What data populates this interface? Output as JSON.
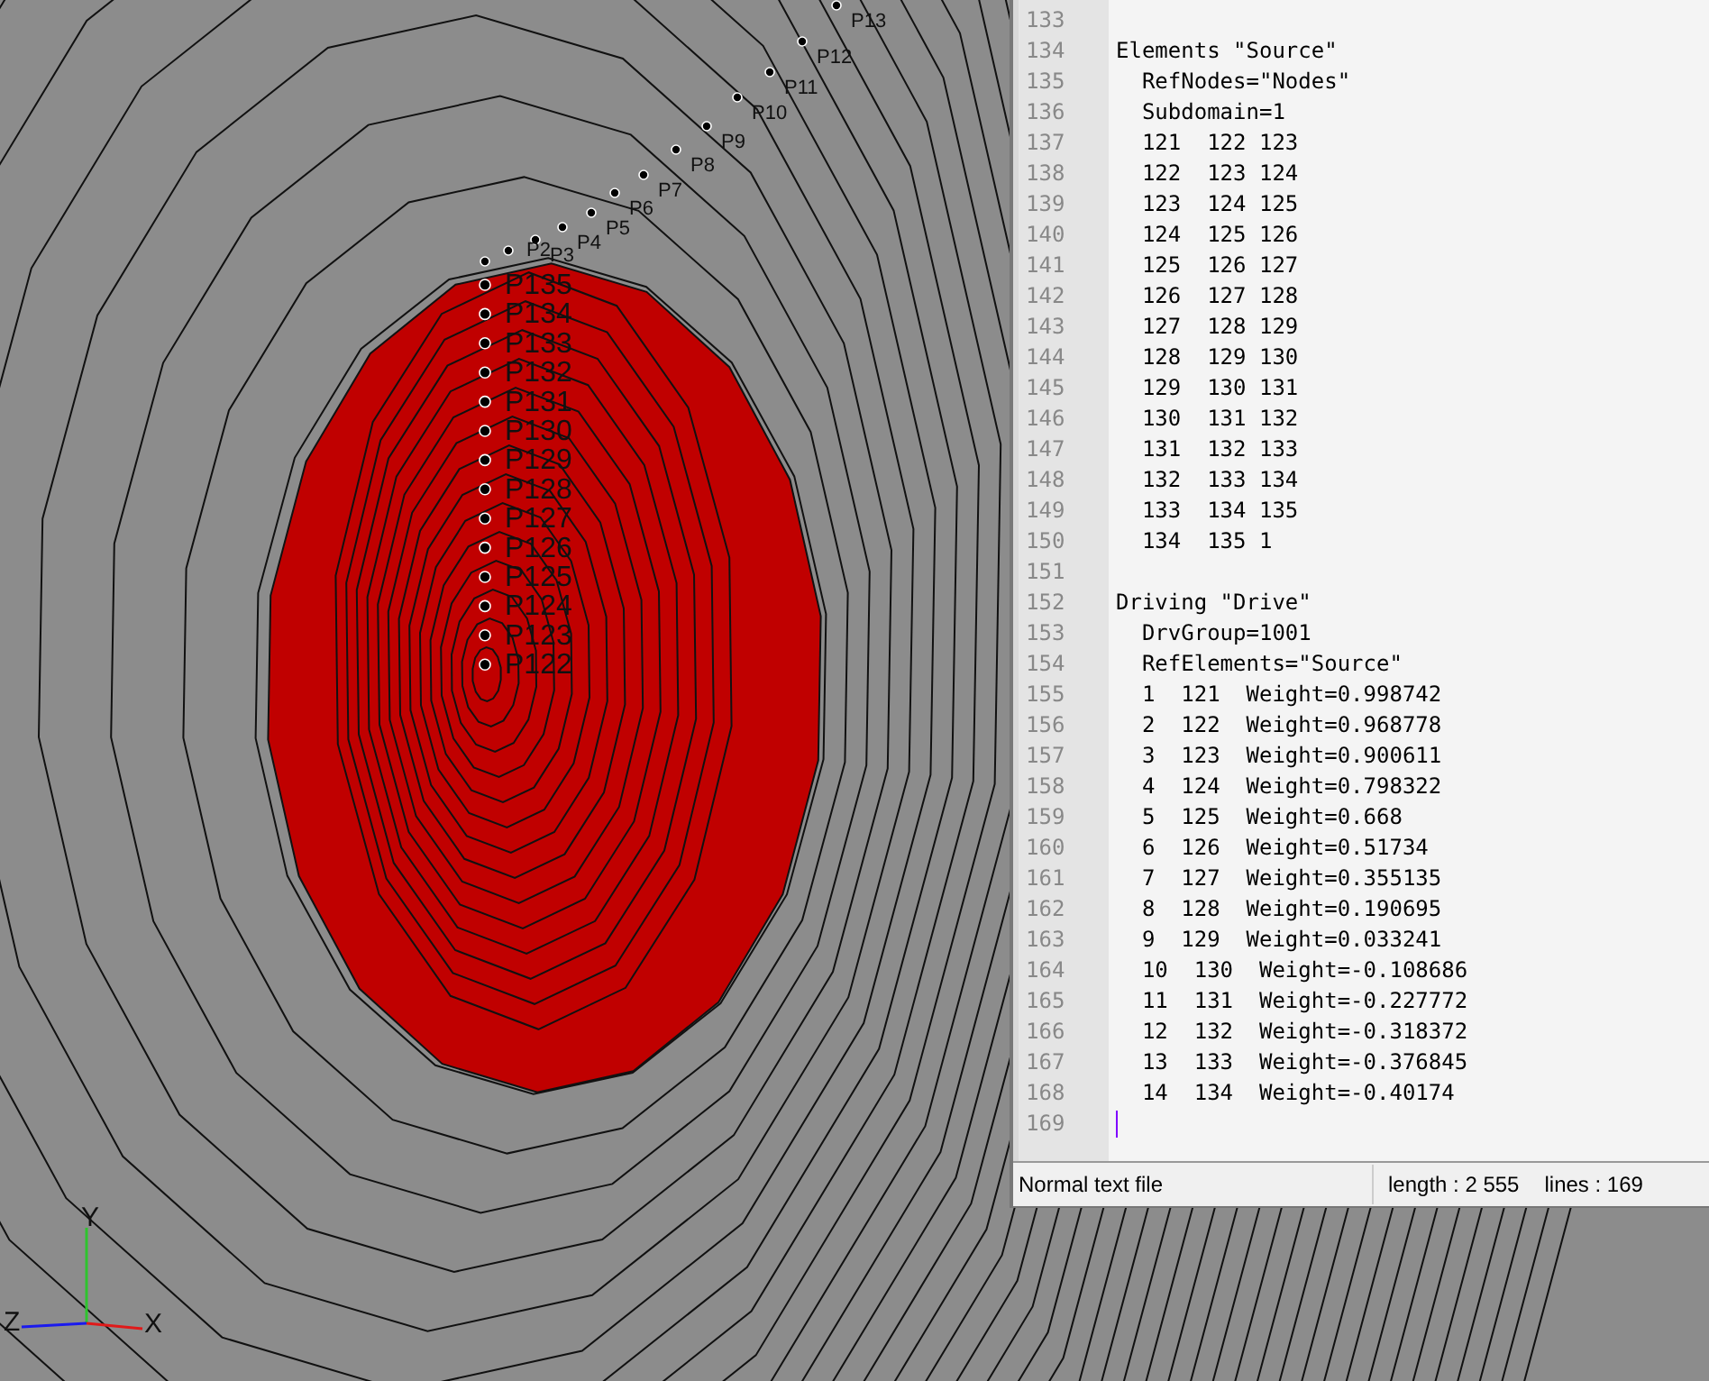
{
  "viewport": {
    "lower_node_labels": [
      "P135",
      "P134",
      "P133",
      "P132",
      "P131",
      "P130",
      "P129",
      "P128",
      "P127",
      "P126",
      "P125",
      "P124",
      "P123",
      "P122"
    ],
    "upper_node_labels": [
      "P2",
      "P3",
      "P4",
      "P5",
      "P6",
      "P7",
      "P8",
      "P9",
      "P10",
      "P11",
      "P12",
      "P13"
    ],
    "axes": {
      "x": "X",
      "y": "Y",
      "z": "Z"
    }
  },
  "editor": {
    "lines": [
      {
        "number": "133"
      },
      {
        "number": "134",
        "text": "Elements \"Source\""
      },
      {
        "number": "135",
        "text": "  RefNodes=\"Nodes\""
      },
      {
        "number": "136",
        "text": "  Subdomain=1"
      },
      {
        "number": "137",
        "text": "  121  122 123"
      },
      {
        "number": "138",
        "text": "  122  123 124"
      },
      {
        "number": "139",
        "text": "  123  124 125"
      },
      {
        "number": "140",
        "text": "  124  125 126"
      },
      {
        "number": "141",
        "text": "  125  126 127"
      },
      {
        "number": "142",
        "text": "  126  127 128"
      },
      {
        "number": "143",
        "text": "  127  128 129"
      },
      {
        "number": "144",
        "text": "  128  129 130"
      },
      {
        "number": "145",
        "text": "  129  130 131"
      },
      {
        "number": "146",
        "text": "  130  131 132"
      },
      {
        "number": "147",
        "text": "  131  132 133"
      },
      {
        "number": "148",
        "text": "  132  133 134"
      },
      {
        "number": "149",
        "text": "  133  134 135"
      },
      {
        "number": "150",
        "text": "  134  135 1"
      },
      {
        "number": "151"
      },
      {
        "number": "152",
        "text": "Driving \"Drive\""
      },
      {
        "number": "153",
        "text": "  DrvGroup=1001"
      },
      {
        "number": "154",
        "text": "  RefElements=\"Source\""
      },
      {
        "number": "155",
        "text": "  1  121  Weight=0.998742"
      },
      {
        "number": "156",
        "text": "  2  122  Weight=0.968778"
      },
      {
        "number": "157",
        "text": "  3  123  Weight=0.900611"
      },
      {
        "number": "158",
        "text": "  4  124  Weight=0.798322"
      },
      {
        "number": "159",
        "text": "  5  125  Weight=0.668"
      },
      {
        "number": "160",
        "text": "  6  126  Weight=0.51734"
      },
      {
        "number": "161",
        "text": "  7  127  Weight=0.355135"
      },
      {
        "number": "162",
        "text": "  8  128  Weight=0.190695"
      },
      {
        "number": "163",
        "text": "  9  129  Weight=0.033241"
      },
      {
        "number": "164",
        "text": "  10  130  Weight=-0.108686"
      },
      {
        "number": "165",
        "text": "  11  131  Weight=-0.227772"
      },
      {
        "number": "166",
        "text": "  12  132  Weight=-0.318372"
      },
      {
        "number": "167",
        "text": "  13  133  Weight=-0.376845"
      },
      {
        "number": "168",
        "text": "  14  134  Weight=-0.40174"
      },
      {
        "number": "169"
      }
    ]
  },
  "status_bar": {
    "file_type": "Normal text file",
    "length": "length : 2 555",
    "lines": "lines : 169"
  }
}
